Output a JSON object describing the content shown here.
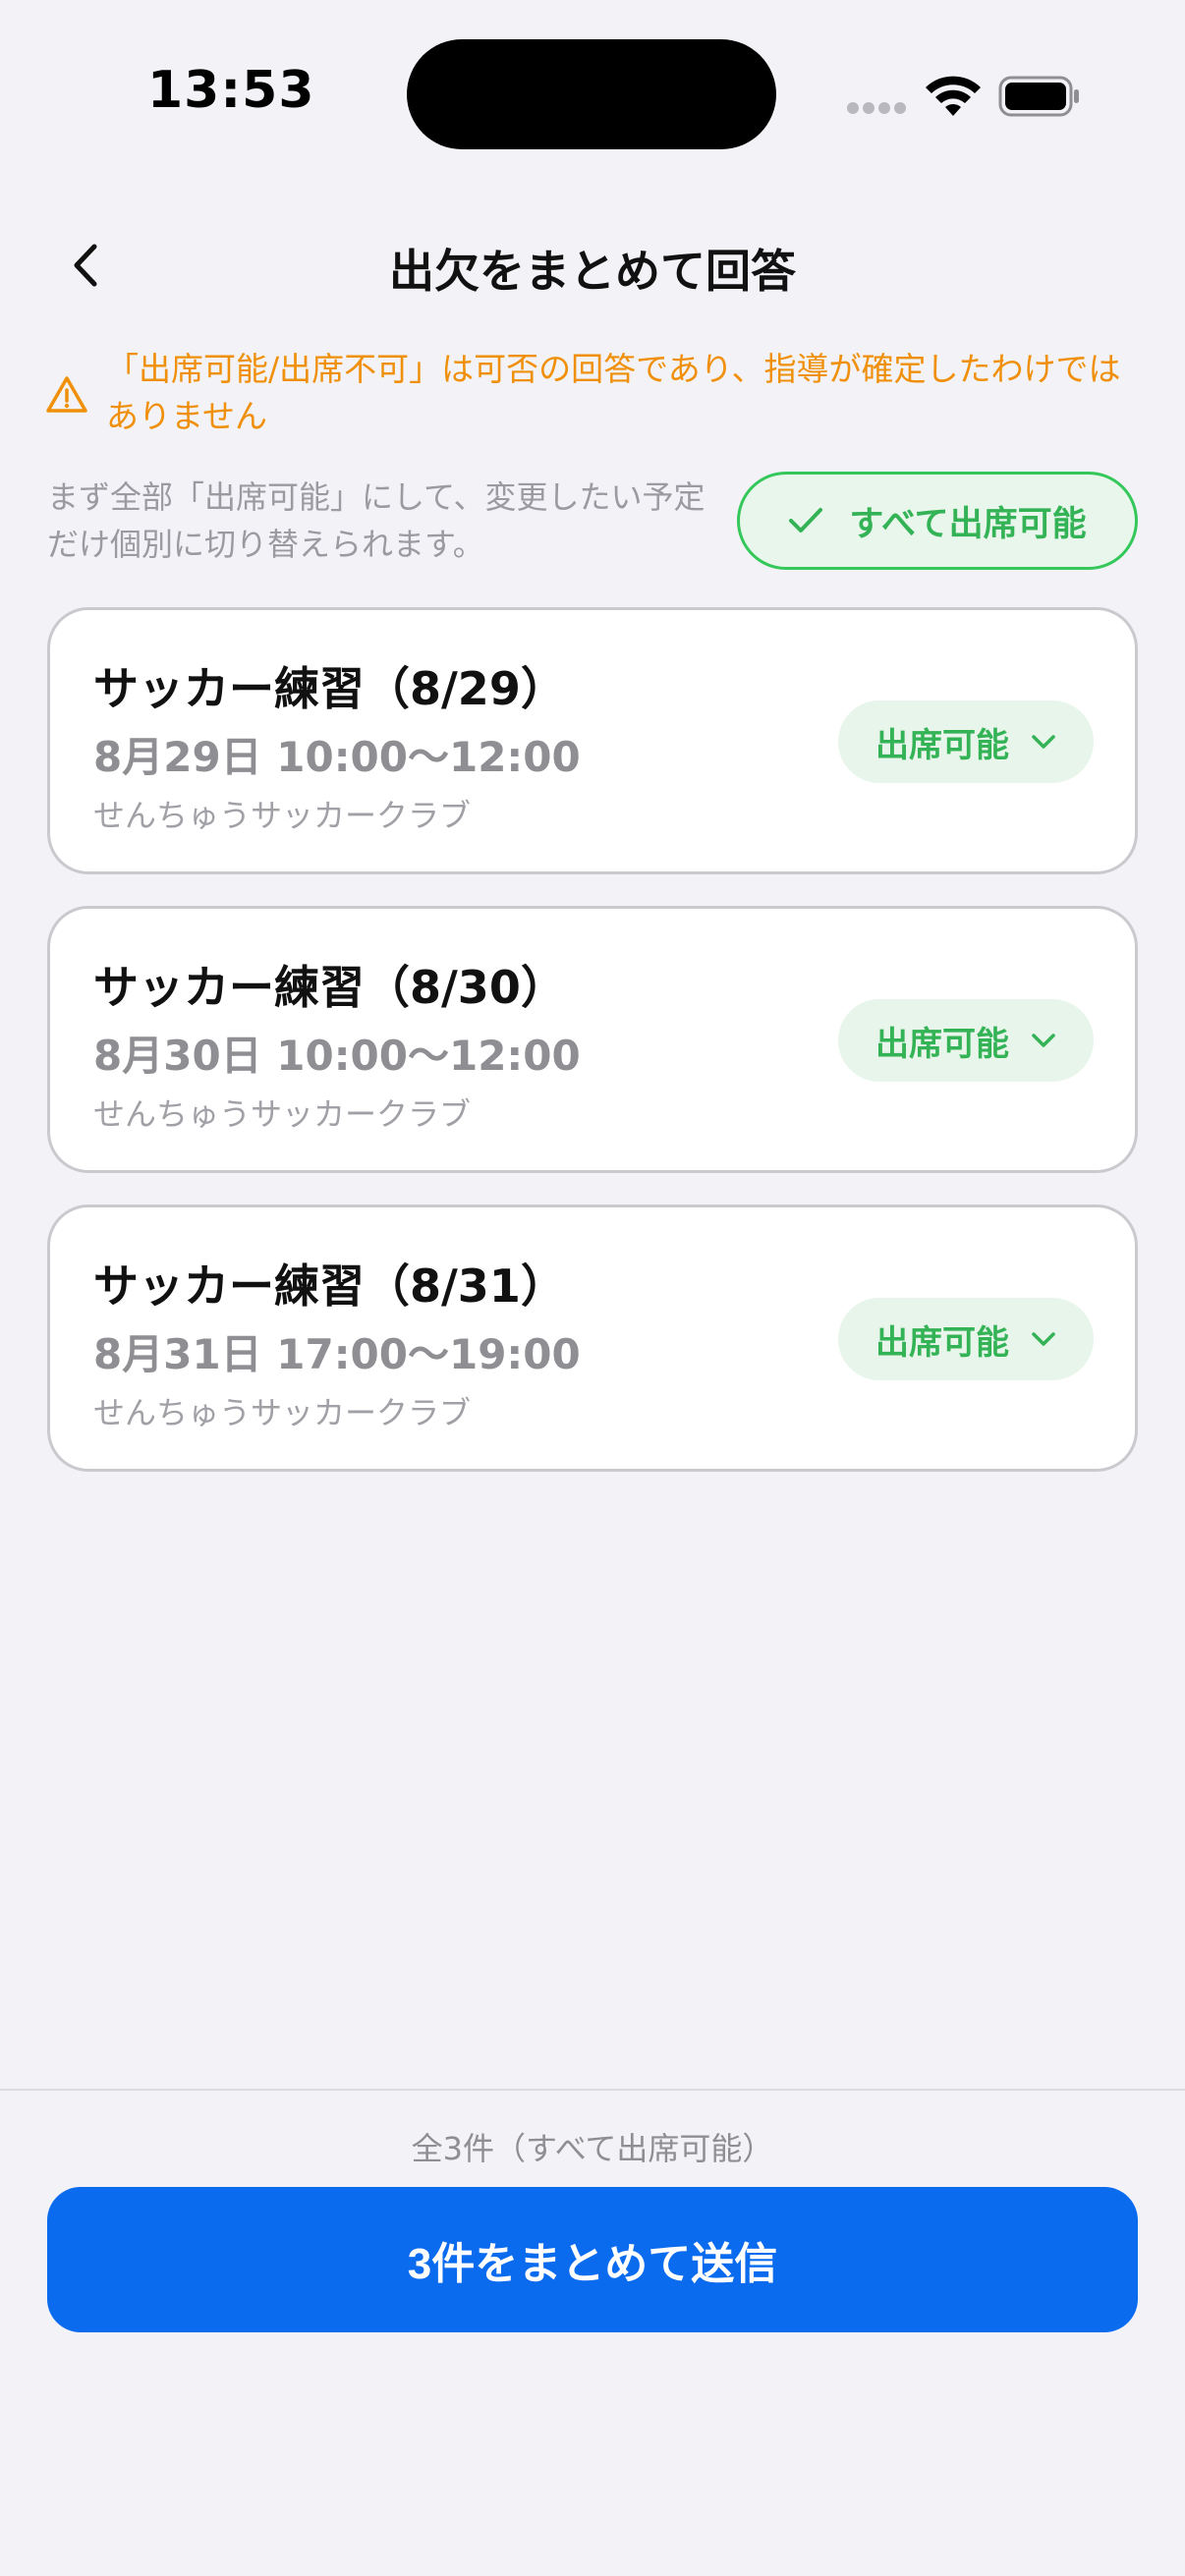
{
  "status_bar": {
    "time": "13:53"
  },
  "nav": {
    "title": "出欠をまとめて回答"
  },
  "warning": {
    "text": "「出席可能/出席不可」は可否の回答であり、指導が確定したわけではありません"
  },
  "hint": {
    "text": "まず全部「出席可能」にして、変更したい予定だけ個別に切り替えられます。",
    "button_label": "すべて出席可能"
  },
  "events": [
    {
      "title": "サッカー練習（8/29）",
      "time": "8月29日 10:00〜12:00",
      "org": "せんちゅうサッカークラブ",
      "status": "出席可能"
    },
    {
      "title": "サッカー練習（8/30）",
      "time": "8月30日 10:00〜12:00",
      "org": "せんちゅうサッカークラブ",
      "status": "出席可能"
    },
    {
      "title": "サッカー練習（8/31）",
      "time": "8月31日 17:00〜19:00",
      "org": "せんちゅうサッカークラブ",
      "status": "出席可能"
    }
  ],
  "footer": {
    "summary": "全3件（すべて出席可能）",
    "submit_label": "3件をまとめて送信"
  },
  "colors": {
    "accent_green": "#34c759",
    "primary_blue": "#0b6bef",
    "warning_orange": "#f0900a"
  }
}
